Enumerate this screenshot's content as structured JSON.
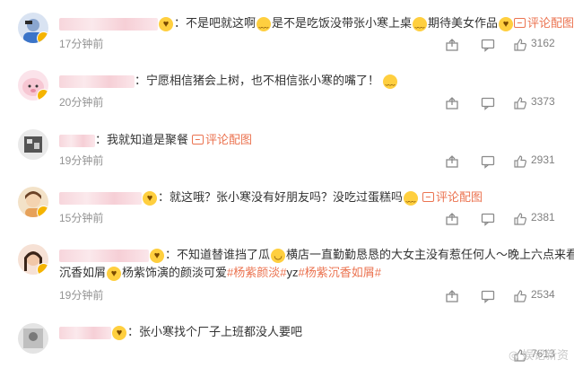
{
  "comments": [
    {
      "segments": [
        "：不是吧就这啊",
        "是不是吃饭没带张小寒上桌",
        "期待美女作品"
      ],
      "link": "评论配图",
      "time": "17分钟前",
      "likes": "3162"
    },
    {
      "segments": [
        "：宁愿相信猪会上树，也不相信张小寒的嘴了！"
      ],
      "time": "20分钟前",
      "likes": "3373"
    },
    {
      "segments": [
        "：我就知道是聚餐"
      ],
      "link": "评论配图",
      "time": "19分钟前",
      "likes": "2931"
    },
    {
      "segments": [
        "：就这哦？张小寒没有好朋友吗？没吃过蛋糕吗"
      ],
      "link": "评论配图",
      "time": "15分钟前",
      "likes": "2381"
    },
    {
      "segments": [
        "：不知道替谁挡了瓜",
        "横店一直勤勤恳恳的大女主没有惹任何人～晚上六点来看",
        "沉香如屑",
        "杨紫饰演的颜淡可爱"
      ],
      "tags": [
        "#杨紫颜淡#",
        "yz",
        "#杨紫沉香如屑#"
      ],
      "time": "19分钟前",
      "likes": "2534"
    },
    {
      "segments": [
        "：张小寒找个厂子上班都没人要吧"
      ],
      "likes": "7613"
    }
  ],
  "watermark": "娱记新资",
  "colors": {
    "link": "#eb7350",
    "time": "#939393",
    "text": "#333333"
  }
}
